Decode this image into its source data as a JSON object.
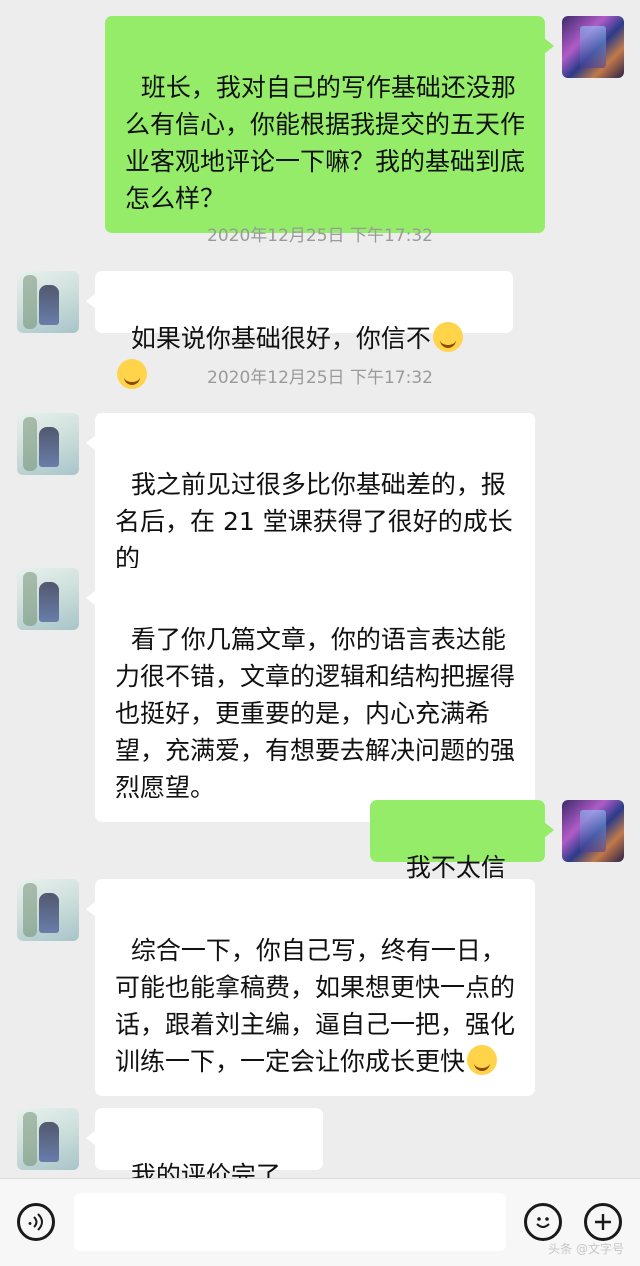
{
  "messages": [
    {
      "text": "班长，我对自己的写作基础还没那么有信心，你能根据我提交的五天作业客观地评论一下嘛？我的基础到底怎么样？"
    },
    {
      "time": "2020年12月25日 下午17:32"
    },
    {
      "text": "如果说你基础很好，你信不"
    },
    {
      "time": "2020年12月25日 下午17:32"
    },
    {
      "text": "我之前见过很多比你基础差的，报名后，在 21 堂课获得了很好的成长的"
    },
    {
      "text": "看了你几篇文章，你的语言表达能力很不错，文章的逻辑和结构把握得也挺好，更重要的是，内心充满希望，充满爱，有想要去解决问题的强烈愿望。"
    },
    {
      "text": "我不太信"
    },
    {
      "text": "综合一下，你自己写，终有一日，可能也能拿稿费，如果想更快一点的话，跟着刘主编，逼自己一把，强化训练一下，一定会让你成长更快"
    },
    {
      "text": "我的评价完了"
    }
  ],
  "icons": {
    "voice": "voice-icon",
    "emoji": "emoji-icon",
    "plus": "plus-icon",
    "crying_laugh": "laughing-crying-emoji",
    "smile": "smile-emoji",
    "grin": "grin-emoji"
  },
  "colors": {
    "self_bubble": "#95ec69",
    "peer_bubble": "#ffffff",
    "background": "#ededed"
  },
  "watermark": "头条 @文字号"
}
